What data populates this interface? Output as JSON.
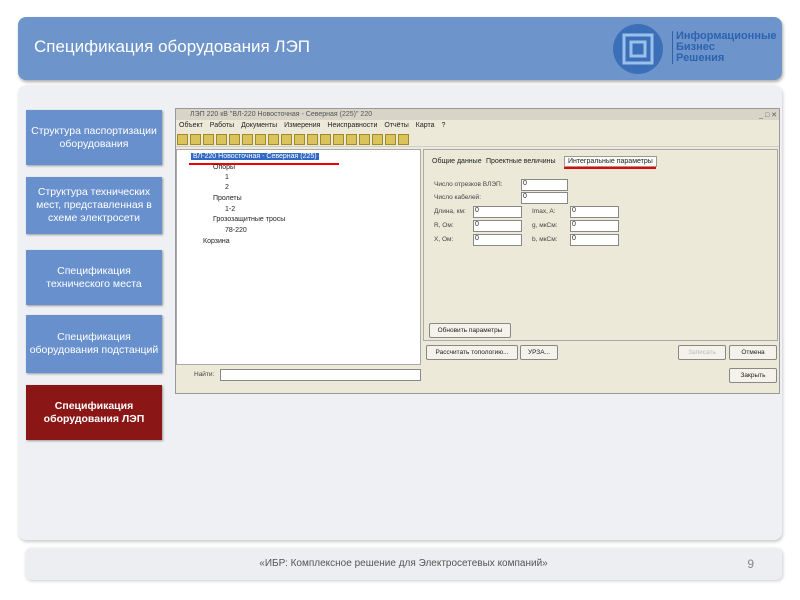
{
  "header": {
    "title": "Спецификация оборудования ЛЭП",
    "logo": [
      "Информационные",
      "Бизнес",
      "Решения"
    ]
  },
  "sidebar": [
    {
      "label": "Структура паспортизации оборудования",
      "active": false
    },
    {
      "label": "Структура технических мест, представленная в схеме электросети",
      "active": false
    },
    {
      "label": "Спецификация технического места",
      "active": false
    },
    {
      "label": "Спецификация оборудования подстанций",
      "active": false
    },
    {
      "label": "Спецификация оборудования ЛЭП",
      "active": true
    }
  ],
  "window": {
    "title": "ЛЭП 220 кВ \"ВЛ-220 Новосточная - Северная (225)\" 220",
    "menu": [
      "Объект",
      "Работы",
      "Документы",
      "Измерения",
      "Неисправности",
      "Отчёты",
      "Карта",
      "?"
    ],
    "tree": {
      "root": "ВЛ-220 Новосточная - Северная (225)",
      "supports": "Опоры",
      "s1": "1",
      "s2": "2",
      "spans": "Пролеты",
      "span1": "1-2",
      "cables": "Грозозащитные тросы",
      "cable1": "78-220",
      "trash": "Корзина"
    },
    "tabs": [
      "Общие данные",
      "Проектные величины",
      "Интегральные параметры"
    ],
    "fields": {
      "segments_label": "Число отрезков ВЛЭП:",
      "segments": "0",
      "cables_label": "Число кабелей:",
      "cables": "0",
      "length_label": "Длина, км:",
      "length": "0",
      "imax_label": "Imax, A:",
      "imax": "0",
      "r_label": "R, Ом:",
      "r": "0",
      "g_label": "g, мкСм:",
      "g": "0",
      "x_label": "X, Ом:",
      "x": "0",
      "b_label": "b, мкСм:",
      "b": "0"
    },
    "buttons": {
      "refresh": "Обновить параметры",
      "topology": "Рассчитать топологию...",
      "urza": "УРЗА...",
      "save": "Записать",
      "cancel": "Отмена",
      "close": "Закрыть"
    },
    "search_label": "Найти:",
    "search_value": ""
  },
  "footer": {
    "text": "«ИБР: Комплексное решение для Электросетевых компаний»",
    "page": "9"
  }
}
